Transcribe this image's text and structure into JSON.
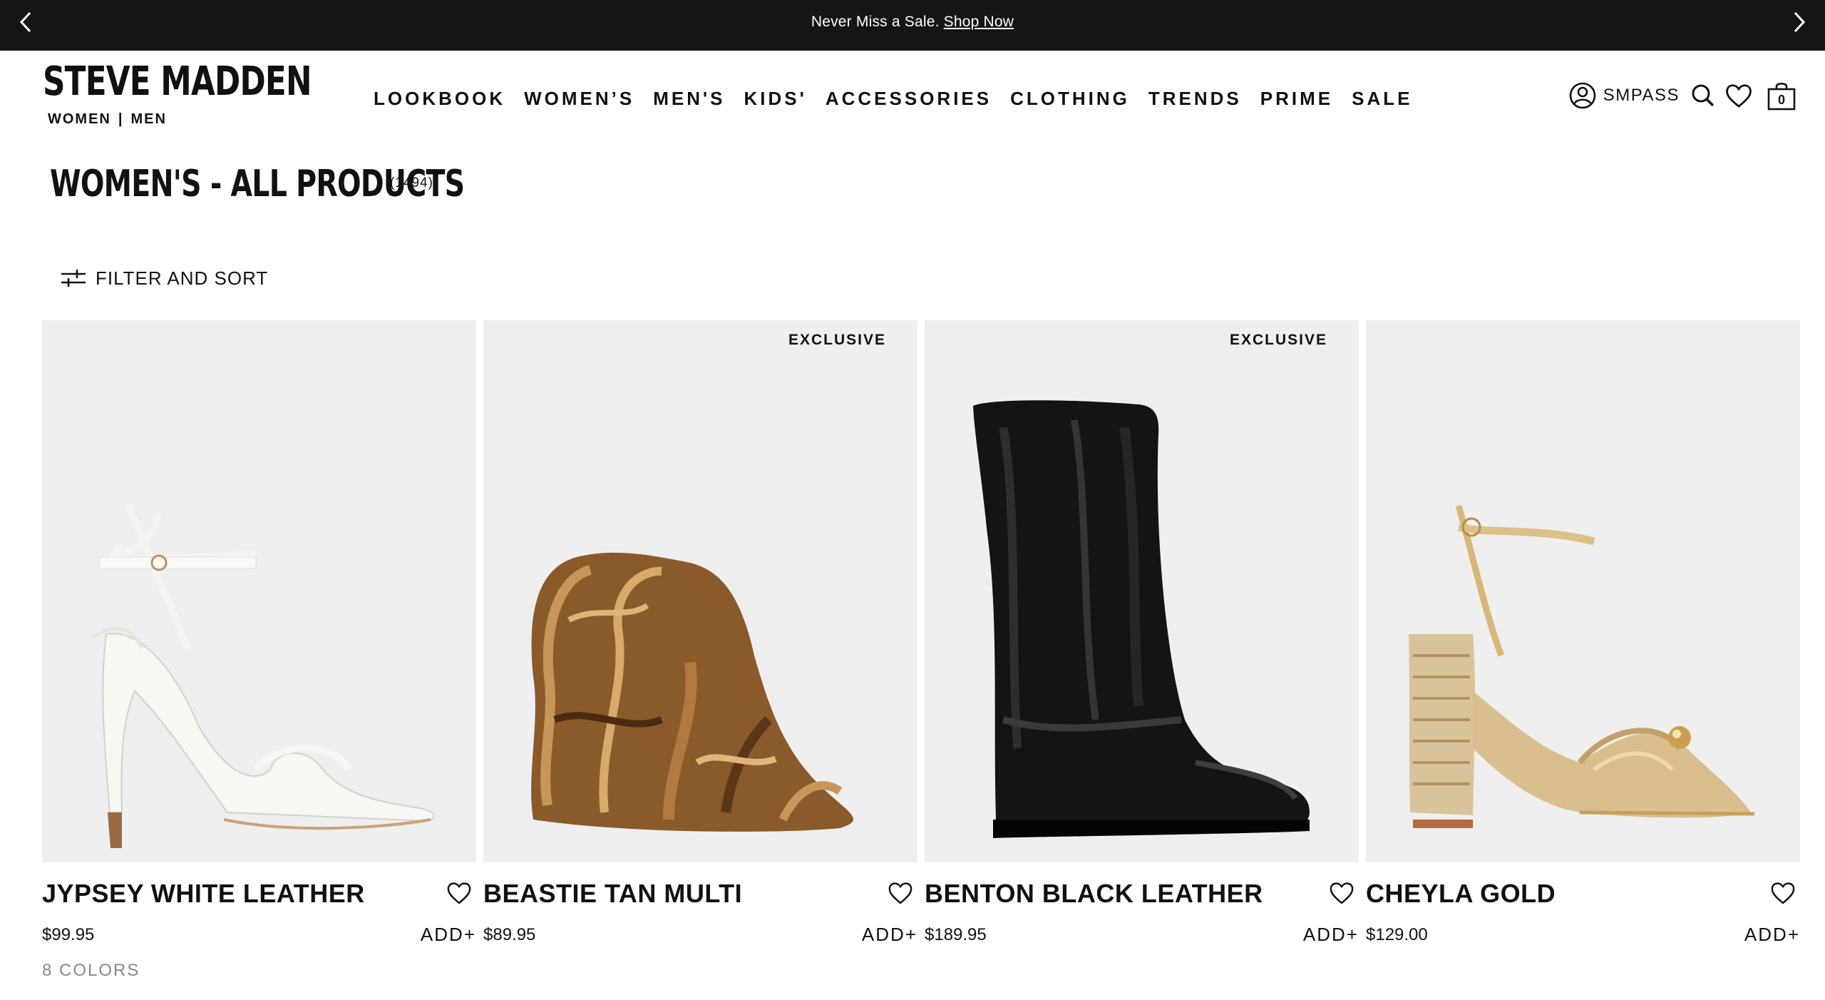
{
  "promo": {
    "message": "Never Miss a Sale.",
    "link": "Shop Now"
  },
  "header": {
    "logo_text": "STEVE MADDEN",
    "logo_sub": [
      "WOMEN",
      "|",
      "MEN"
    ],
    "nav": [
      "LOOKBOOK",
      "WOMEN’S",
      "MEN'S",
      "KIDS'",
      "ACCESSORIES",
      "CLOTHING",
      "TRENDS",
      "PRIME",
      "SALE"
    ],
    "account_label": "SMPASS",
    "bag_count": "0",
    "icons": [
      "account-icon",
      "search-icon",
      "wishlist-heart-icon",
      "shopping-bag-icon"
    ]
  },
  "page": {
    "title": "WOMEN'S - ALL PRODUCTS",
    "count": "(1494)",
    "filter_label": "FILTER AND SORT"
  },
  "products": [
    {
      "name": "JYPSEY WHITE LEATHER",
      "price": "$99.95",
      "add_label": "ADD+",
      "badge": "",
      "colors": "8 COLORS"
    },
    {
      "name": "BEASTIE TAN MULTI",
      "price": "$89.95",
      "add_label": "ADD+",
      "badge": "EXCLUSIVE",
      "colors": ""
    },
    {
      "name": "BENTON BLACK LEATHER",
      "price": "$189.95",
      "add_label": "ADD+",
      "badge": "EXCLUSIVE",
      "colors": ""
    },
    {
      "name": "CHEYLA GOLD",
      "price": "$129.00",
      "add_label": "ADD+",
      "badge": "",
      "colors": ""
    }
  ],
  "colors": {
    "promo_bg": "#151515",
    "image_bg": "#efefef",
    "text": "#111111",
    "muted": "#888888"
  }
}
